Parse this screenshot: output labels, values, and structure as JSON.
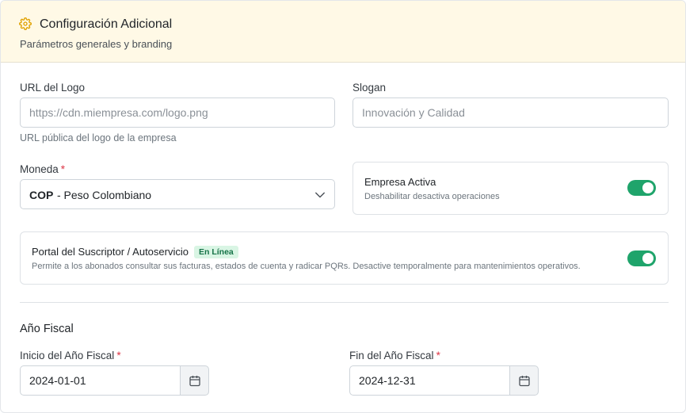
{
  "header": {
    "icon": "gear-icon",
    "title": "Configuración Adicional",
    "subtitle": "Parámetros generales y branding"
  },
  "logo_url": {
    "label": "URL del Logo",
    "placeholder": "https://cdn.miempresa.com/logo.png",
    "value": "",
    "help": "URL pública del logo de la empresa"
  },
  "slogan": {
    "label": "Slogan",
    "placeholder": "Innovación y Calidad",
    "value": ""
  },
  "currency": {
    "label": "Moneda",
    "required_mark": "*",
    "selected_code": "COP",
    "selected_name": "- Peso Colombiano",
    "icon": "chevron-down-icon"
  },
  "active_company": {
    "title": "Empresa Activa",
    "description": "Deshabilitar desactiva operaciones",
    "enabled": true
  },
  "portal": {
    "title": "Portal del Suscriptor / Autoservicio",
    "badge": "En Línea",
    "description": "Permite a los abonados consultar sus facturas, estados de cuenta y radicar PQRs. Desactive temporalmente para mantenimientos operativos.",
    "enabled": true
  },
  "fiscal_year": {
    "section_title": "Año Fiscal",
    "start": {
      "label": "Inicio del Año Fiscal",
      "required_mark": "*",
      "value": "2024-01-01",
      "icon": "calendar-icon"
    },
    "end": {
      "label": "Fin del Año Fiscal",
      "required_mark": "*",
      "value": "2024-12-31",
      "icon": "calendar-icon"
    }
  },
  "colors": {
    "header_bg": "#fff9e6",
    "accent_icon": "#e0a100",
    "toggle_on": "#1fa46b",
    "badge_bg": "#d9f5e4",
    "badge_text": "#157347",
    "required": "#dc3545"
  }
}
